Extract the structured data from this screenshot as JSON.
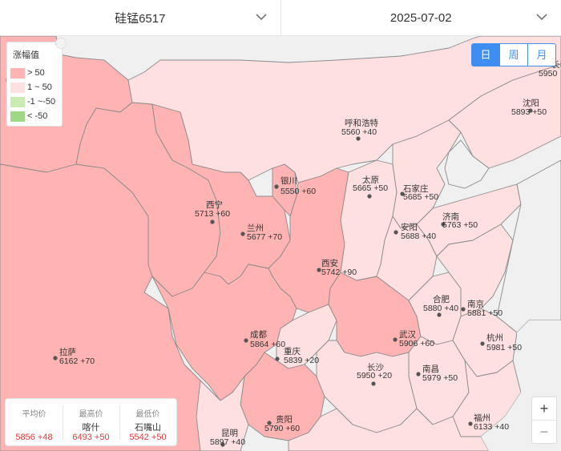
{
  "selectors": {
    "product": "硅锰6517",
    "date": "2025-07-02"
  },
  "legend": {
    "title": "涨幅值",
    "items": [
      {
        "label": "> 50",
        "color": "#ffb3b3"
      },
      {
        "label": "1 ~ 50",
        "color": "#ffe0e0"
      },
      {
        "label": "-1 ~-50",
        "color": "#c9ecb2"
      },
      {
        "label": "< -50",
        "color": "#9fd886"
      }
    ]
  },
  "period_tabs": [
    {
      "label": "日",
      "active": true
    },
    {
      "label": "周",
      "active": false
    },
    {
      "label": "月",
      "active": false
    }
  ],
  "cities": [
    {
      "name": "沈阳",
      "price": "5893",
      "change": "+50"
    },
    {
      "name": "呼和浩特",
      "price": "5560",
      "change": "+40"
    },
    {
      "name": "银川",
      "price": "5550",
      "change": "+60"
    },
    {
      "name": "太原",
      "price": "5665",
      "change": "+50"
    },
    {
      "name": "石家庄",
      "price": "5685",
      "change": "+50"
    },
    {
      "name": "西宁",
      "price": "5713",
      "change": "+60"
    },
    {
      "name": "兰州",
      "price": "5677",
      "change": "+70"
    },
    {
      "name": "济南",
      "price": "5763",
      "change": "+50"
    },
    {
      "name": "安阳",
      "price": "5688",
      "change": "+40"
    },
    {
      "name": "西安",
      "price": "5742",
      "change": "+90"
    },
    {
      "name": "合肥",
      "price": "5880",
      "change": "+40"
    },
    {
      "name": "南京",
      "price": "5881",
      "change": "+50"
    },
    {
      "name": "成都",
      "price": "5864",
      "change": "+60"
    },
    {
      "name": "武汉",
      "price": "5906",
      "change": "+60"
    },
    {
      "name": "杭州",
      "price": "5981",
      "change": "+50"
    },
    {
      "name": "拉萨",
      "price": "6162",
      "change": "+70"
    },
    {
      "name": "重庆",
      "price": "5839",
      "change": "+20"
    },
    {
      "name": "长沙",
      "price": "5950",
      "change": "+20"
    },
    {
      "name": "南昌",
      "price": "5979",
      "change": "+50"
    },
    {
      "name": "福州",
      "price": "6133",
      "change": "+40"
    },
    {
      "name": "贵阳",
      "price": "5790",
      "change": "+60"
    },
    {
      "name": "昆明",
      "price": "5897",
      "change": "+40"
    }
  ],
  "edge_label_partial": "5950",
  "edge_label_partial_name": "长春",
  "stats": [
    {
      "title": "平均价",
      "name": "",
      "value": "5856 +48"
    },
    {
      "title": "最高价",
      "name": "喀什",
      "value": "6493 +50"
    },
    {
      "title": "最低价",
      "name": "石嘴山",
      "value": "5542 +50"
    }
  ],
  "zoom": {
    "in": "+",
    "out": "−"
  },
  "colors": {
    "high": "#ffb3b3",
    "mid": "#ffe0e0",
    "ocean": "#f0f0f0",
    "accent": "#3d8ef0",
    "up_text": "#e03c3c"
  }
}
